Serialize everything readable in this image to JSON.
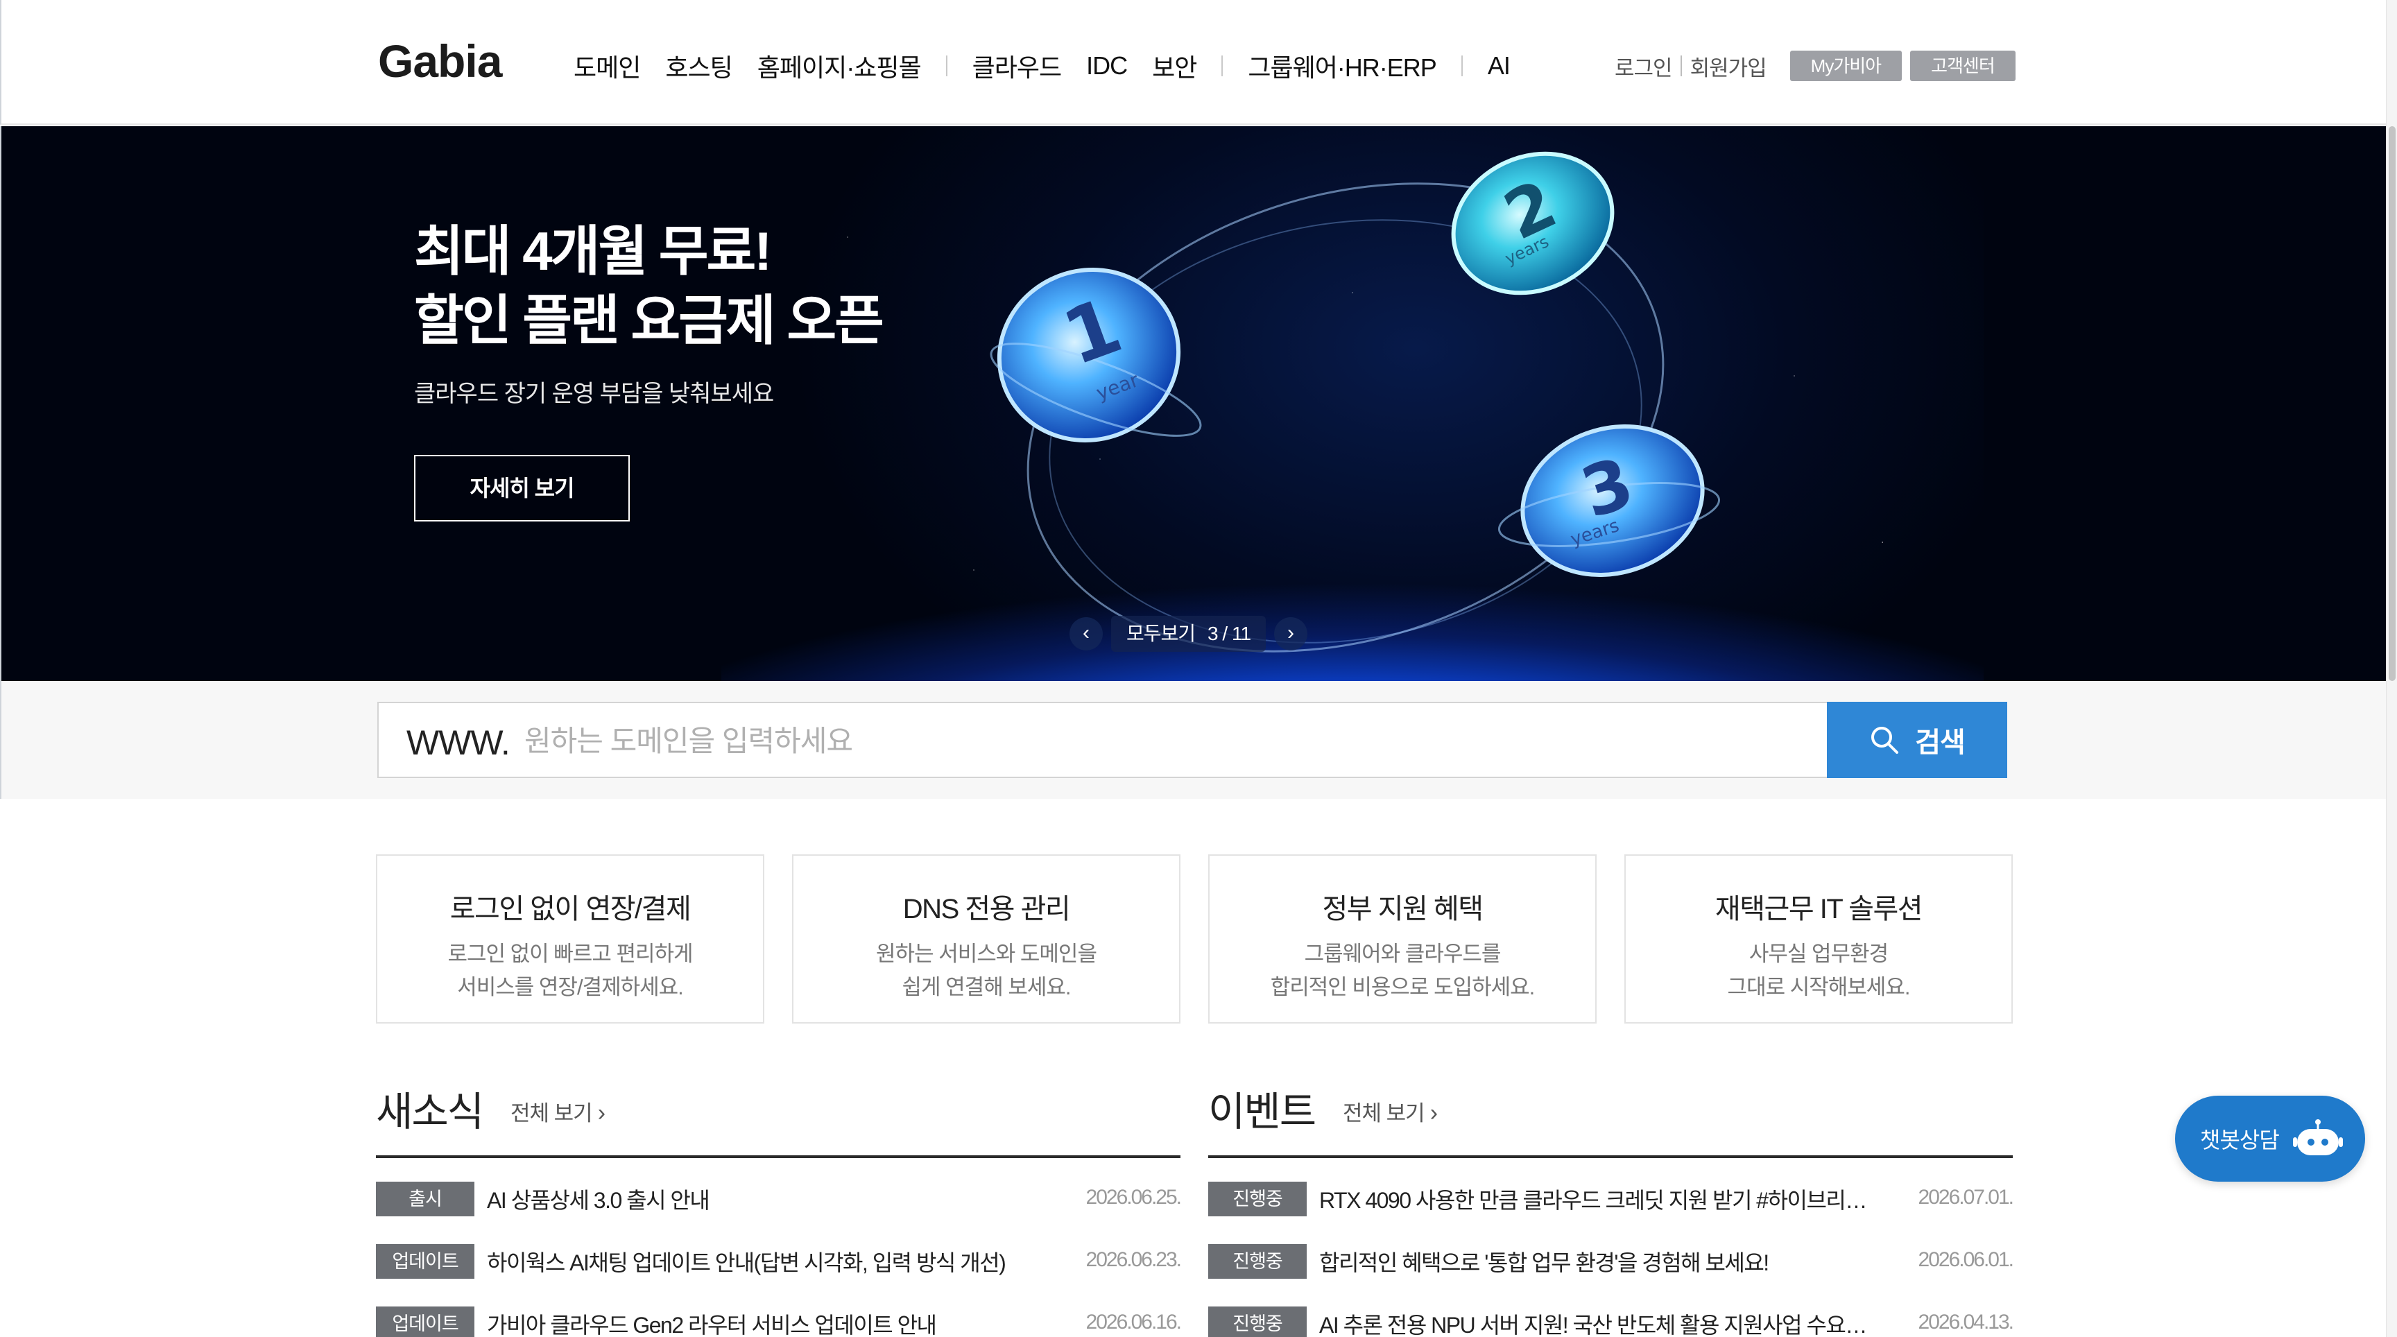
{
  "header": {
    "logo": "Gabia",
    "nav": [
      {
        "label": "도메인"
      },
      {
        "label": "호스팅"
      },
      {
        "label": "홈페이지·쇼핑몰"
      },
      {
        "label": "클라우드"
      },
      {
        "label": "IDC"
      },
      {
        "label": "보안"
      },
      {
        "label": "그룹웨어·HR·ERP"
      },
      {
        "label": "AI"
      }
    ],
    "login": "로그인",
    "signup": "회원가입",
    "mygabia": "My가비아",
    "support": "고객센터"
  },
  "hero": {
    "title_line1": "최대 4개월 무료!",
    "title_line2": "할인 플랜 요금제 오픈",
    "subtitle": "클라우드 장기 운영 부담을 낮춰보세요",
    "cta": "자세히 보기",
    "view_all": "모두보기",
    "page_indicator": "3 / 11",
    "coin1_num": "1",
    "coin1_label": "year",
    "coin2_num": "2",
    "coin2_label": "years",
    "coin3_num": "3",
    "coin3_label": "years"
  },
  "search": {
    "prefix": "WWW.",
    "placeholder": "원하는 도메인을 입력하세요",
    "value": "",
    "button": "검색"
  },
  "cards": [
    {
      "title": "로그인 없이 연장/결제",
      "desc1": "로그인 없이 빠르고 편리하게",
      "desc2": "서비스를 연장/결제하세요."
    },
    {
      "title": "DNS 전용 관리",
      "desc1": "원하는 서비스와 도메인을",
      "desc2": "쉽게 연결해 보세요."
    },
    {
      "title": "정부 지원 혜택",
      "desc1": "그룹웨어와 클라우드를",
      "desc2": "합리적인 비용으로 도입하세요."
    },
    {
      "title": "재택근무 IT 솔루션",
      "desc1": "사무실 업무환경",
      "desc2": "그대로 시작해보세요."
    }
  ],
  "news": {
    "heading": "새소식",
    "more": "전체 보기",
    "items": [
      {
        "tag": "출시",
        "title": "AI 상품상세 3.0 출시 안내",
        "date": "2026.06.25."
      },
      {
        "tag": "업데이트",
        "title": "하이웍스 AI채팅 업데이트 안내(답변 시각화, 입력 방식 개선)",
        "date": "2026.06.23."
      },
      {
        "tag": "업데이트",
        "title": "가비아 클라우드 Gen2 라우터 서비스 업데이트 안내",
        "date": "2026.06.16."
      }
    ]
  },
  "events": {
    "heading": "이벤트",
    "more": "전체 보기",
    "items": [
      {
        "tag": "진행중",
        "title": "RTX 4090 사용한 만큼 클라우드 크레딧 지원 받기 #하이브리…",
        "date": "2026.07.01."
      },
      {
        "tag": "진행중",
        "title": "합리적인 혜택으로 '통합 업무 환경'을 경험해 보세요!",
        "date": "2026.06.01."
      },
      {
        "tag": "진행중",
        "title": "AI 추론 전용 NPU 서버 지원! 국산 반도체 활용 지원사업 수요…",
        "date": "2026.04.13."
      }
    ]
  },
  "chatbot": {
    "label": "챗봇상담"
  },
  "colors": {
    "accent": "#2f87d6",
    "tag": "#6b6e73",
    "chatbot": "#1f7acb",
    "chip": "#9ea0a5"
  }
}
